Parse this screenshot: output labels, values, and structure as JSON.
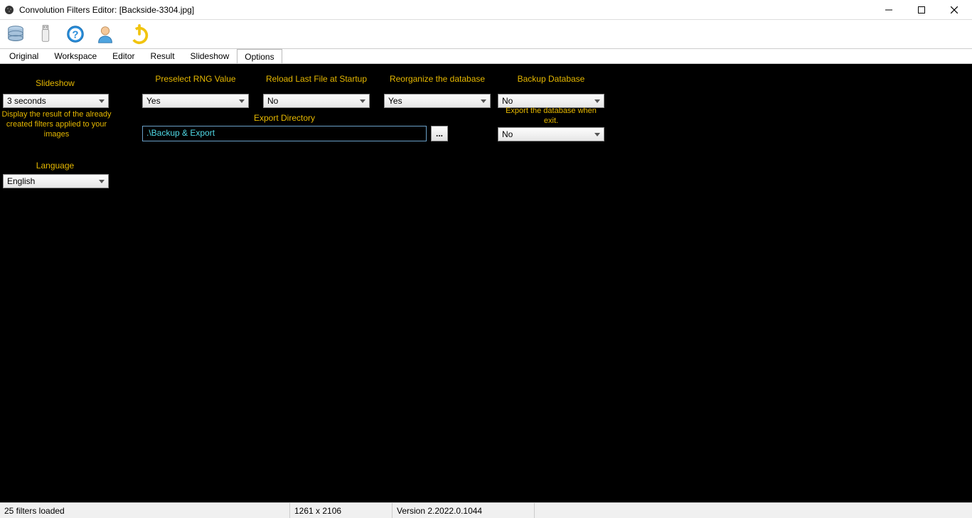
{
  "window": {
    "title": "Convolution Filters Editor: [Backside-3304.jpg]"
  },
  "tabs": {
    "t0": "Original",
    "t1": "Workspace",
    "t2": "Editor",
    "t3": "Result",
    "t4": "Slideshow",
    "t5": "Options"
  },
  "labels": {
    "slideshow": "Slideshow",
    "slideshow_desc": "Display the result of the already created filters applied to your images",
    "language": "Language",
    "preselect_rng": "Preselect RNG Value",
    "export_dir": "Export Directory",
    "reload_last": "Reload Last File at Startup",
    "reorganize": "Reorganize the database",
    "backup_db": "Backup Database",
    "export_on_exit": "Export the database when exit."
  },
  "values": {
    "slideshow_interval": "3 seconds",
    "language": "English",
    "preselect_rng": "Yes",
    "reload_last": "No",
    "reorganize": "Yes",
    "backup_db": "No",
    "export_on_exit": "No",
    "export_dir": ".\\Backup & Export",
    "browse_btn": "..."
  },
  "status": {
    "filters": "25 filters loaded",
    "dims": "1261 x 2106",
    "version": "Version 2.2022.0.1044"
  }
}
